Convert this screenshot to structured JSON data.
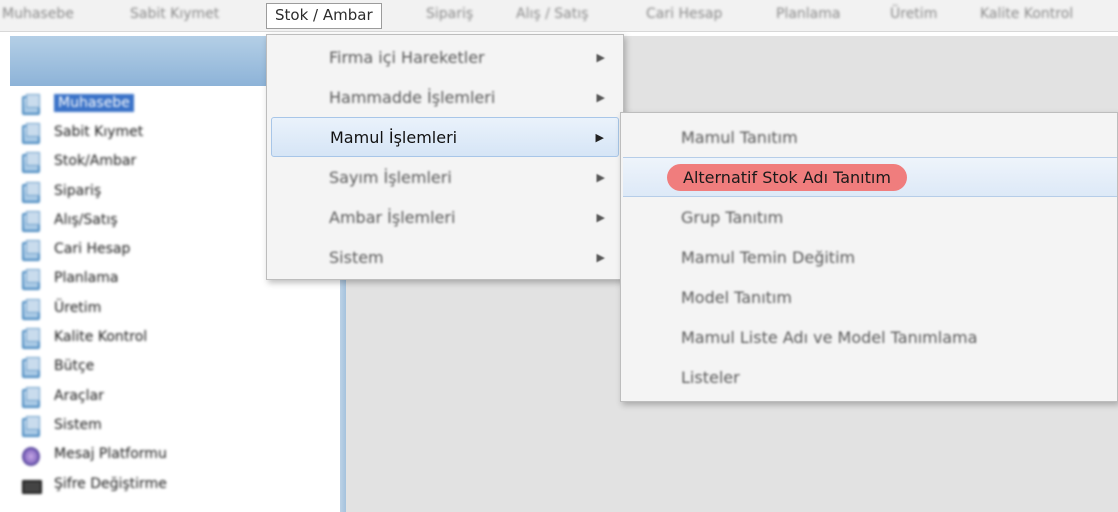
{
  "menubar": {
    "items": [
      {
        "label": "Muhasebe"
      },
      {
        "label": "Sabit Kıymet"
      },
      {
        "label": "Stok / Ambar"
      },
      {
        "label": "Sipariş"
      },
      {
        "label": "Alış / Satış"
      },
      {
        "label": "Cari Hesap"
      },
      {
        "label": "Planlama"
      },
      {
        "label": "Üretim"
      },
      {
        "label": "Kalite Kontrol"
      }
    ]
  },
  "tree": {
    "items": [
      {
        "label": "Muhasebe",
        "icon": "folder-icon"
      },
      {
        "label": "Sabit Kıymet",
        "icon": "folder-icon"
      },
      {
        "label": "Stok/Ambar",
        "icon": "folder-icon"
      },
      {
        "label": "Sipariş",
        "icon": "folder-icon"
      },
      {
        "label": "Alış/Satış",
        "icon": "folder-icon"
      },
      {
        "label": "Cari Hesap",
        "icon": "folder-icon"
      },
      {
        "label": "Planlama",
        "icon": "folder-icon"
      },
      {
        "label": "Üretim",
        "icon": "folder-icon"
      },
      {
        "label": "Kalite Kontrol",
        "icon": "folder-icon"
      },
      {
        "label": "Bütçe",
        "icon": "folder-icon"
      },
      {
        "label": "Araçlar",
        "icon": "folder-icon"
      },
      {
        "label": "Sistem",
        "icon": "folder-icon"
      },
      {
        "label": "Mesaj Platformu",
        "icon": "globe-icon"
      },
      {
        "label": "Şifre Değiştirme",
        "icon": "keys-icon"
      }
    ]
  },
  "submenu1": {
    "items": [
      {
        "label": "Firma içi Hareketler",
        "arrow": "▶"
      },
      {
        "label": "Hammadde İşlemleri",
        "arrow": "▶"
      },
      {
        "label": "Mamul İşlemleri",
        "arrow": "▶"
      },
      {
        "label": "Sayım İşlemleri",
        "arrow": "▶"
      },
      {
        "label": "Ambar İşlemleri",
        "arrow": "▶"
      },
      {
        "label": "Sistem",
        "arrow": "▶"
      }
    ]
  },
  "submenu2": {
    "items": [
      {
        "label": "Mamul Tanıtım"
      },
      {
        "label": "Alternatif Stok Adı Tanıtım"
      },
      {
        "label": "Grup Tanıtım"
      },
      {
        "label": "Mamul Temin Değitim"
      },
      {
        "label": "Model Tanıtım"
      },
      {
        "label": "Mamul Liste Adı ve Model Tanımlama"
      },
      {
        "label": "Listeler"
      }
    ]
  },
  "colors": {
    "highlight_pill": "#f07d7d",
    "selection_blue": "#3a72c8",
    "panel_header": "#8db3d8"
  }
}
